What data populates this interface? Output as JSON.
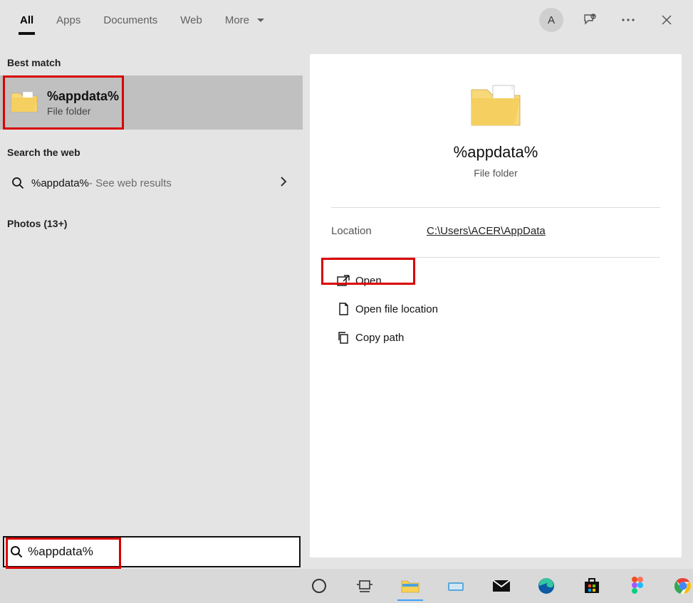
{
  "tabs": {
    "all": "All",
    "apps": "Apps",
    "documents": "Documents",
    "web": "Web",
    "more": "More"
  },
  "header": {
    "avatar_letter": "A"
  },
  "left": {
    "best_match_label": "Best match",
    "best_match": {
      "title": "%appdata%",
      "subtitle": "File folder"
    },
    "search_web_label": "Search the web",
    "web_result": {
      "term": "%appdata%",
      "hint": " - See web results"
    },
    "photos_label": "Photos (13+)"
  },
  "right": {
    "title": "%appdata%",
    "subtitle": "File folder",
    "location_label": "Location",
    "location_path": "C:\\Users\\ACER\\AppData",
    "actions": {
      "open": "Open",
      "open_location": "Open file location",
      "copy_path": "Copy path"
    }
  },
  "searchbar": {
    "value": "%appdata%"
  }
}
